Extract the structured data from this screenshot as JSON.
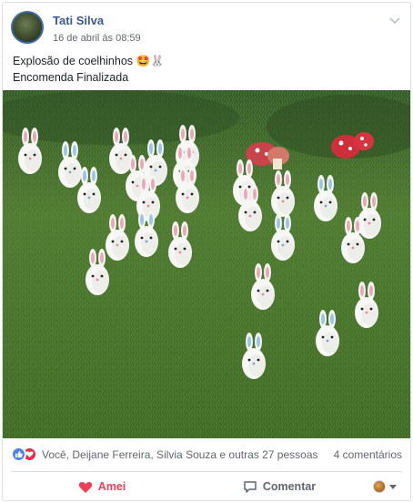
{
  "post": {
    "author": "Tati Silva",
    "timestamp": "16 de abril às 08:59",
    "text_line1": "Explosão de coelhinhos 🤩🐰",
    "text_line2": "Encomenda Finalizada"
  },
  "reactions": {
    "names": "Você, Deijane Ferreira, Silvia Souza e outras 27 pessoas",
    "comments": "4 comentários"
  },
  "actions": {
    "love_label": "Amei",
    "comment_label": "Comentar"
  },
  "icons": {
    "options": "chevron-down-icon",
    "like": "like-icon",
    "love": "heart-icon",
    "comment": "comment-icon",
    "audience": "profile-avatar-icon"
  },
  "colors": {
    "author_link": "#385898",
    "love_red": "#f33e58",
    "like_blue": "#4b81ef"
  }
}
